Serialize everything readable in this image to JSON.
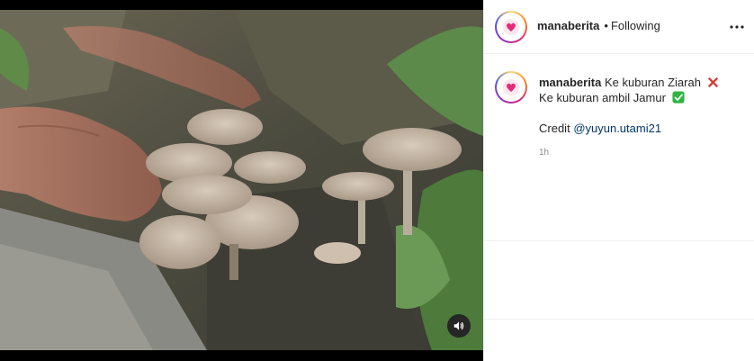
{
  "post": {
    "video": {
      "mute_icon": "speaker-icon"
    },
    "header": {
      "username": "manaberita",
      "separator": "•",
      "follow_status": "Following",
      "more_icon": "more-horizontal-icon"
    },
    "caption": {
      "username": "manaberita",
      "line1": "Ke kuburan Ziarah",
      "line1_emoji": "cross-mark-icon",
      "line2": "Ke kuburan ambil Jamur",
      "line2_emoji": "check-mark-button-icon",
      "credit_prefix": "Credit",
      "credit_mention": "@yuyun.utami21",
      "timestamp": "1h"
    },
    "colors": {
      "brand_pink": "#e8297a",
      "link": "#00376b",
      "muted": "#8e8e8e",
      "check_green": "#2fb344",
      "cross_red": "#d73a3a"
    }
  }
}
